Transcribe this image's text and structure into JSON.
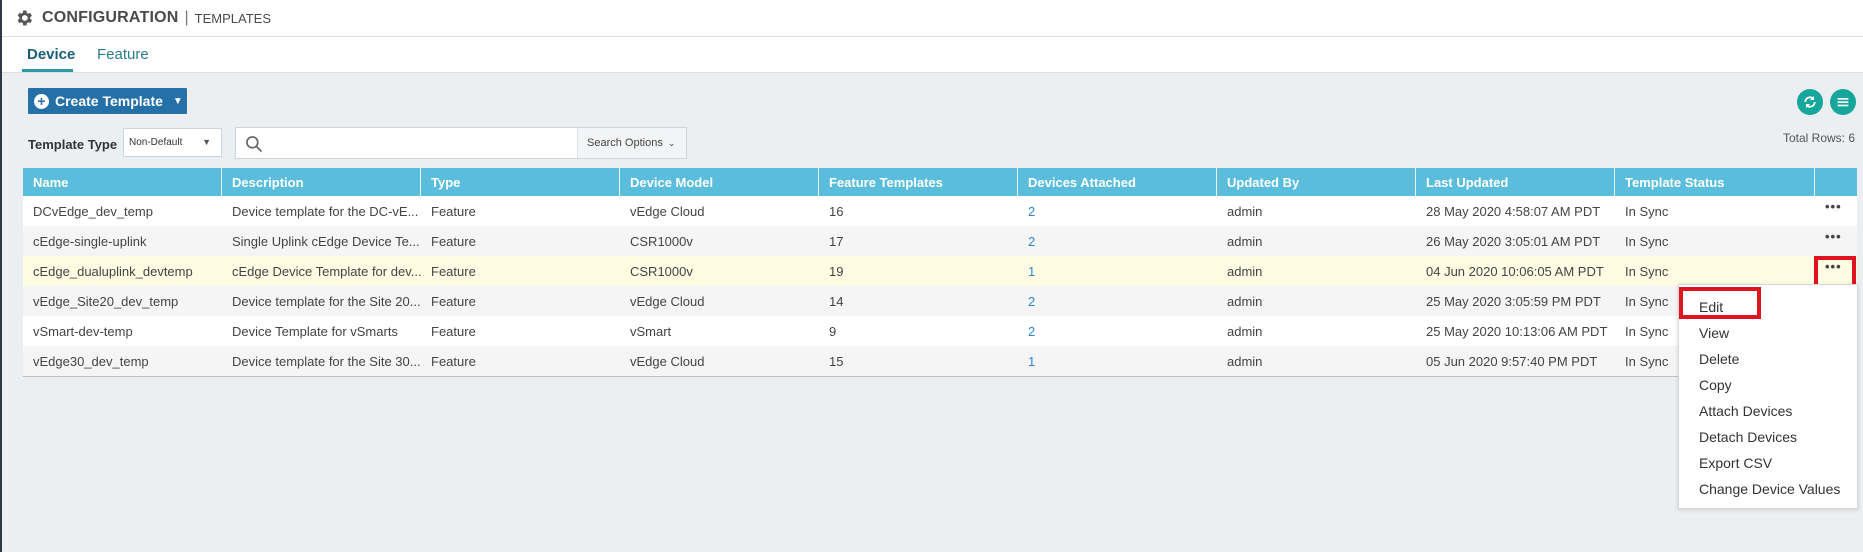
{
  "header": {
    "title": "CONFIGURATION",
    "separator": "|",
    "subtitle": "TEMPLATES"
  },
  "tabs": [
    {
      "label": "Device",
      "active": true
    },
    {
      "label": "Feature",
      "active": false
    }
  ],
  "toolbar": {
    "create_label": "Create Template",
    "template_type_label": "Template Type",
    "template_type_value": "Non-Default",
    "search_placeholder": "",
    "search_options_label": "Search Options",
    "total_rows": "Total Rows: 6"
  },
  "table": {
    "columns": [
      "Name",
      "Description",
      "Type",
      "Device Model",
      "Feature Templates",
      "Devices Attached",
      "Updated By",
      "Last Updated",
      "Template Status"
    ],
    "rows": [
      [
        "DCvEdge_dev_temp",
        "Device template for the DC-vE...",
        "Feature",
        "vEdge Cloud",
        "16",
        "2",
        "admin",
        "28 May 2020 4:58:07 AM PDT",
        "In Sync"
      ],
      [
        "cEdge-single-uplink",
        "Single Uplink cEdge Device Te...",
        "Feature",
        "CSR1000v",
        "17",
        "2",
        "admin",
        "26 May 2020 3:05:01 AM PDT",
        "In Sync"
      ],
      [
        "cEdge_dualuplink_devtemp",
        "cEdge Device Template for dev...",
        "Feature",
        "CSR1000v",
        "19",
        "1",
        "admin",
        "04 Jun 2020 10:06:05 AM PDT",
        "In Sync"
      ],
      [
        "vEdge_Site20_dev_temp",
        "Device template for the Site 20...",
        "Feature",
        "vEdge Cloud",
        "14",
        "2",
        "admin",
        "25 May 2020 3:05:59 PM PDT",
        "In Sync"
      ],
      [
        "vSmart-dev-temp",
        "Device Template for vSmarts",
        "Feature",
        "vSmart",
        "9",
        "2",
        "admin",
        "25 May 2020 10:13:06 AM PDT",
        "In Sync"
      ],
      [
        "vEdge30_dev_temp",
        "Device template for the Site 30...",
        "Feature",
        "vEdge Cloud",
        "15",
        "1",
        "admin",
        "05 Jun 2020 9:57:40 PM PDT",
        "In Sync"
      ]
    ],
    "row_action_label": "•••"
  },
  "context_menu": {
    "items": [
      "Edit",
      "View",
      "Delete",
      "Copy",
      "Attach Devices",
      "Detach Devices",
      "Export CSV",
      "Change Device Values"
    ]
  },
  "colors": {
    "accent": "#2670a8",
    "header_row": "#5bbddc",
    "teal": "#17a69b",
    "highlight": "#e0141f"
  },
  "icons": {
    "header": "gear-icon",
    "refresh": "refresh-icon",
    "menu": "hamburger-menu-icon",
    "search": "search-icon"
  }
}
